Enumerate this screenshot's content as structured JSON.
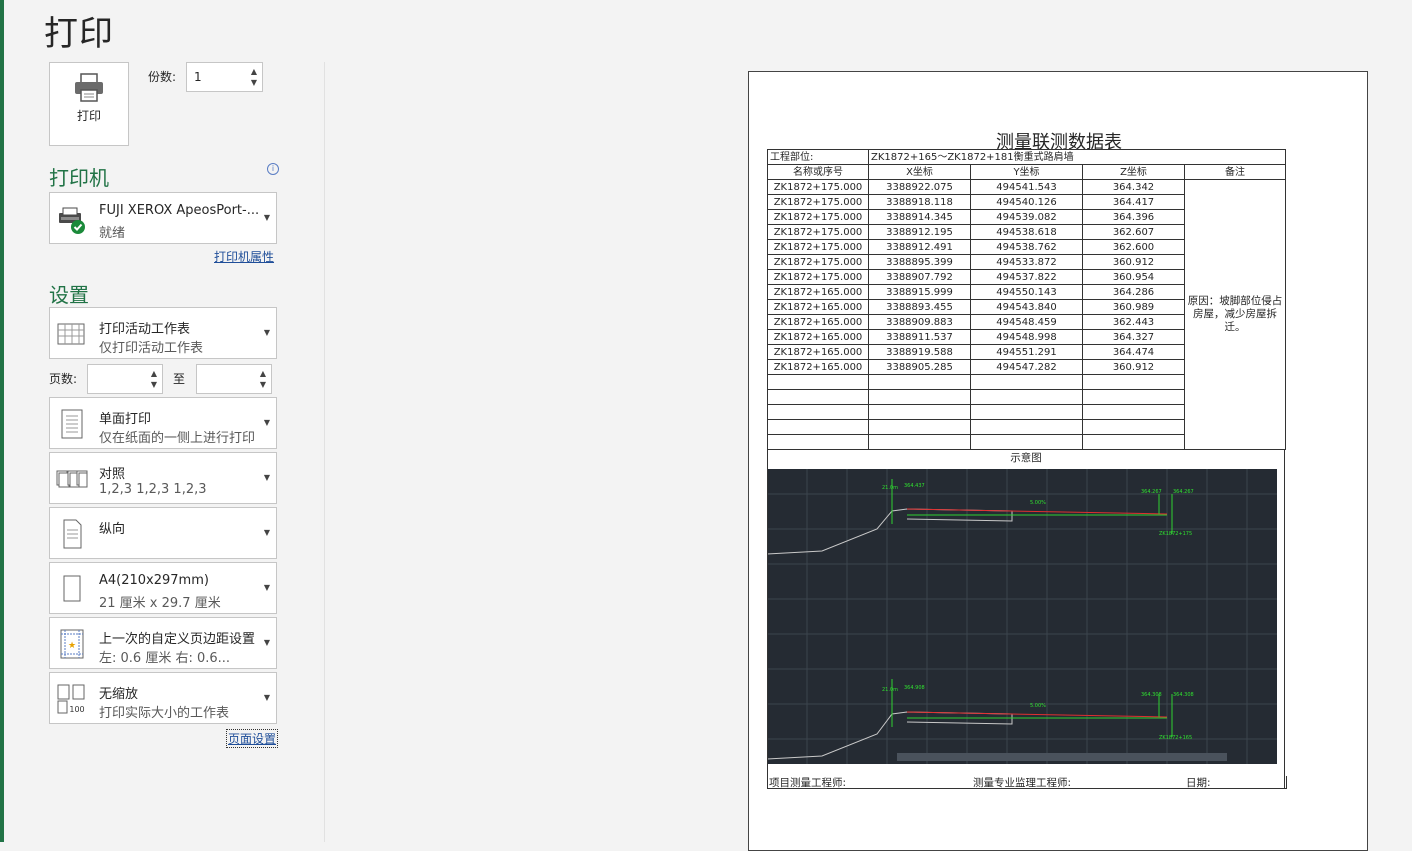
{
  "page_title": "打印",
  "print_button": "打印",
  "copies": {
    "label": "份数:",
    "value": "1"
  },
  "printer": {
    "section": "打印机",
    "info": "i",
    "name": "FUJI XEROX ApeosPort-...",
    "status": "就绪",
    "properties_link": "打印机属性"
  },
  "settings": {
    "section": "设置",
    "scope": {
      "title": "打印活动工作表",
      "sub": "仅打印活动工作表"
    },
    "pages": {
      "label": "页数:",
      "to": "至",
      "from_value": "",
      "to_value": ""
    },
    "sides": {
      "title": "单面打印",
      "sub": "仅在纸面的一侧上进行打印"
    },
    "collate": {
      "title": "对照",
      "sub": "1,2,3    1,2,3    1,2,3"
    },
    "orientation": {
      "title": "纵向",
      "sub": ""
    },
    "paper": {
      "title": "A4(210x297mm)",
      "sub": "21 厘米 x 29.7 厘米"
    },
    "margins": {
      "title": "上一次的自定义页边距设置",
      "sub": "左:  0.6 厘米     右:  0.6..."
    },
    "scaling": {
      "title": "无缩放",
      "sub": "打印实际大小的工作表"
    },
    "page_setup_link": "页面设置"
  },
  "preview": {
    "title": "测量联测数据表",
    "project_label": "工程部位:",
    "project_value": "ZK1872+165～ZK1872+181衡重式路肩墙",
    "headers": [
      "名称或序号",
      "X坐标",
      "Y坐标",
      "Z坐标",
      "备注"
    ],
    "rows": [
      [
        "ZK1872+175.000",
        "3388922.075",
        "494541.543",
        "364.342"
      ],
      [
        "ZK1872+175.000",
        "3388918.118",
        "494540.126",
        "364.417"
      ],
      [
        "ZK1872+175.000",
        "3388914.345",
        "494539.082",
        "364.396"
      ],
      [
        "ZK1872+175.000",
        "3388912.195",
        "494538.618",
        "362.607"
      ],
      [
        "ZK1872+175.000",
        "3388912.491",
        "494538.762",
        "362.600"
      ],
      [
        "ZK1872+175.000",
        "3388895.399",
        "494533.872",
        "360.912"
      ],
      [
        "ZK1872+175.000",
        "3388907.792",
        "494537.822",
        "360.954"
      ],
      [
        "ZK1872+165.000",
        "3388915.999",
        "494550.143",
        "364.286"
      ],
      [
        "ZK1872+165.000",
        "3388893.455",
        "494543.840",
        "360.989"
      ],
      [
        "ZK1872+165.000",
        "3388909.883",
        "494548.459",
        "362.443"
      ],
      [
        "ZK1872+165.000",
        "3388911.537",
        "494548.998",
        "364.327"
      ],
      [
        "ZK1872+165.000",
        "3388919.588",
        "494551.291",
        "364.474"
      ],
      [
        "ZK1872+165.000",
        "3388905.285",
        "494547.282",
        "360.912"
      ]
    ],
    "remark": "原因：坡脚部位侵占房屋，减少房屋拆迁。",
    "diagram_label": "示意图",
    "diagram_texts": {
      "top_left_a": "364.437",
      "top_right_a": "364.267",
      "top_right_b": "364.267",
      "slope_a": "5.00%",
      "station_a": "ZK1872+175",
      "height_a": "21.0m",
      "top_left_b": "364.908",
      "bot_right_a": "364.308",
      "bot_right_b": "364.308",
      "slope_b": "5.00%",
      "station_b": "ZK1872+165",
      "height_b": "21.0m"
    },
    "footer": {
      "engineer": "项目测量工程师:",
      "supervisor": "测量专业监理工程师:",
      "date": "日期:"
    }
  },
  "colors": {
    "accent": "#217346",
    "link": "#1f4e99"
  }
}
